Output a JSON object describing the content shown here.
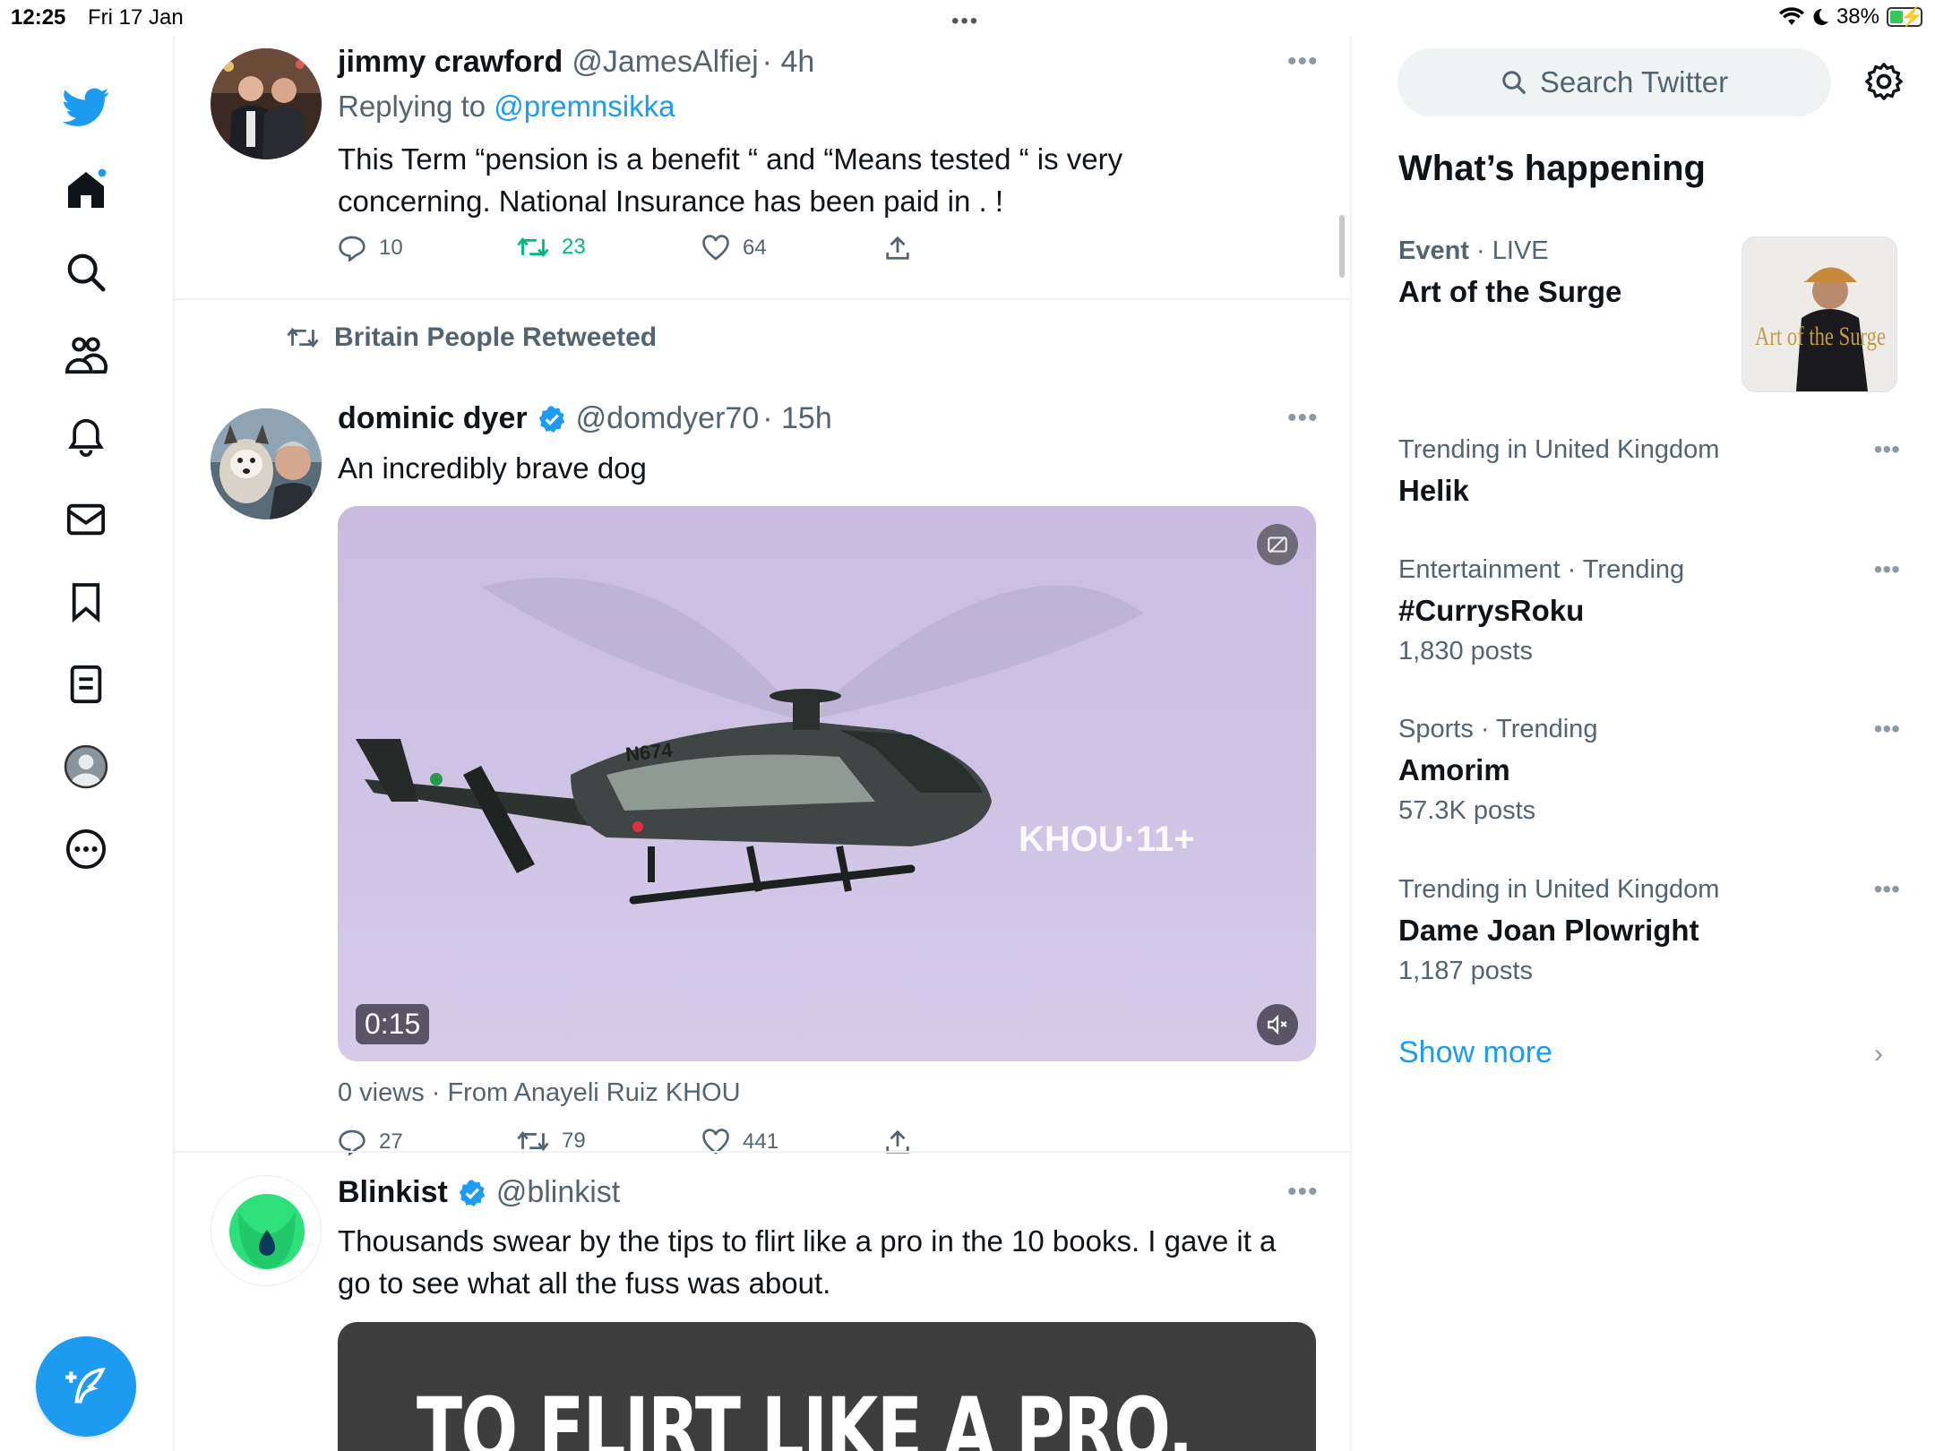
{
  "status_bar": {
    "time": "12:25",
    "date": "Fri 17 Jan",
    "battery": "38%",
    "battery_level": 0.38
  },
  "nav": {
    "items": [
      "twitter-logo",
      "home",
      "explore",
      "communities",
      "notifications",
      "messages",
      "bookmarks",
      "lists",
      "profile",
      "more"
    ],
    "compose_icon": "compose-tweet-icon"
  },
  "tweets": [
    {
      "name": "jimmy crawford",
      "handle": "@JamesAlfiej",
      "time": "· 4h",
      "replying_prefix": "Replying to ",
      "replying_to": "@premnsikka",
      "text_line1": "This Term “pension is a benefit “  and “Means tested “ is very",
      "text_line2": "concerning. National Insurance has been paid in . !",
      "replies": "10",
      "retweets": "23",
      "likes": "64"
    },
    {
      "retweeted_by": "Britain People Retweeted",
      "name": "dominic dyer",
      "handle": "@domdyer70",
      "time": "· 15h",
      "text": "An incredibly brave dog",
      "video_duration": "0:15",
      "video_watermark": "KHOU·11+",
      "video_tail_number": "N674",
      "views_line": "0 views · From Anayeli Ruiz KHOU",
      "replies": "27",
      "retweets": "79",
      "likes": "441"
    },
    {
      "name": "Blinkist",
      "handle": "@blinkist",
      "text_line1": "Thousands swear by the tips to flirt like a pro in the 10 books. I gave it a",
      "text_line2": "go to see what all the fuss was about.",
      "media_text": "TO FLIRT LIKE A PRO."
    }
  ],
  "sidebar": {
    "search_placeholder": "Search Twitter",
    "heading": "What’s happening",
    "event": {
      "context_bold": "Event",
      "context_rest": " · LIVE",
      "title": "Art of the Surge",
      "thumb_text": "Art of the Surge"
    },
    "trends": [
      {
        "context": "Trending in United Kingdom",
        "title": "Helik",
        "count": ""
      },
      {
        "context": "Entertainment · Trending",
        "title": "#CurrysRoku",
        "count": "1,830 posts"
      },
      {
        "context": "Sports · Trending",
        "title": "Amorim",
        "count": "57.3K posts"
      },
      {
        "context": "Trending in United Kingdom",
        "title": "Dame Joan Plowright",
        "count": "1,187 posts"
      }
    ],
    "show_more": "Show more"
  },
  "colors": {
    "accent": "#1d9bf0",
    "retweet_green": "#00ba7c",
    "secondary_text": "#536471"
  }
}
